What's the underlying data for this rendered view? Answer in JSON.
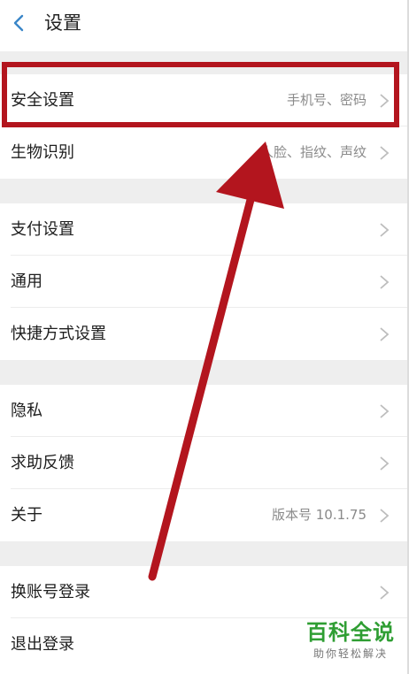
{
  "header": {
    "title": "设置"
  },
  "groups": [
    {
      "rows": [
        {
          "label": "安全设置",
          "value": "手机号、密码"
        },
        {
          "label": "生物识别",
          "value": "人脸、指纹、声纹"
        }
      ]
    },
    {
      "rows": [
        {
          "label": "支付设置",
          "value": ""
        },
        {
          "label": "通用",
          "value": ""
        },
        {
          "label": "快捷方式设置",
          "value": ""
        }
      ]
    },
    {
      "rows": [
        {
          "label": "隐私",
          "value": ""
        },
        {
          "label": "求助反馈",
          "value": ""
        },
        {
          "label": "关于",
          "value": "版本号 10.1.75"
        }
      ]
    },
    {
      "rows": [
        {
          "label": "换账号登录",
          "value": ""
        },
        {
          "label": "退出登录",
          "value": ""
        }
      ]
    }
  ],
  "watermark": {
    "title": "百科全说",
    "subtitle": "助你轻松解决"
  },
  "colors": {
    "annotation": "#b3151e",
    "watermark": "#2f9e33",
    "section_gap": "#eeeeee"
  }
}
